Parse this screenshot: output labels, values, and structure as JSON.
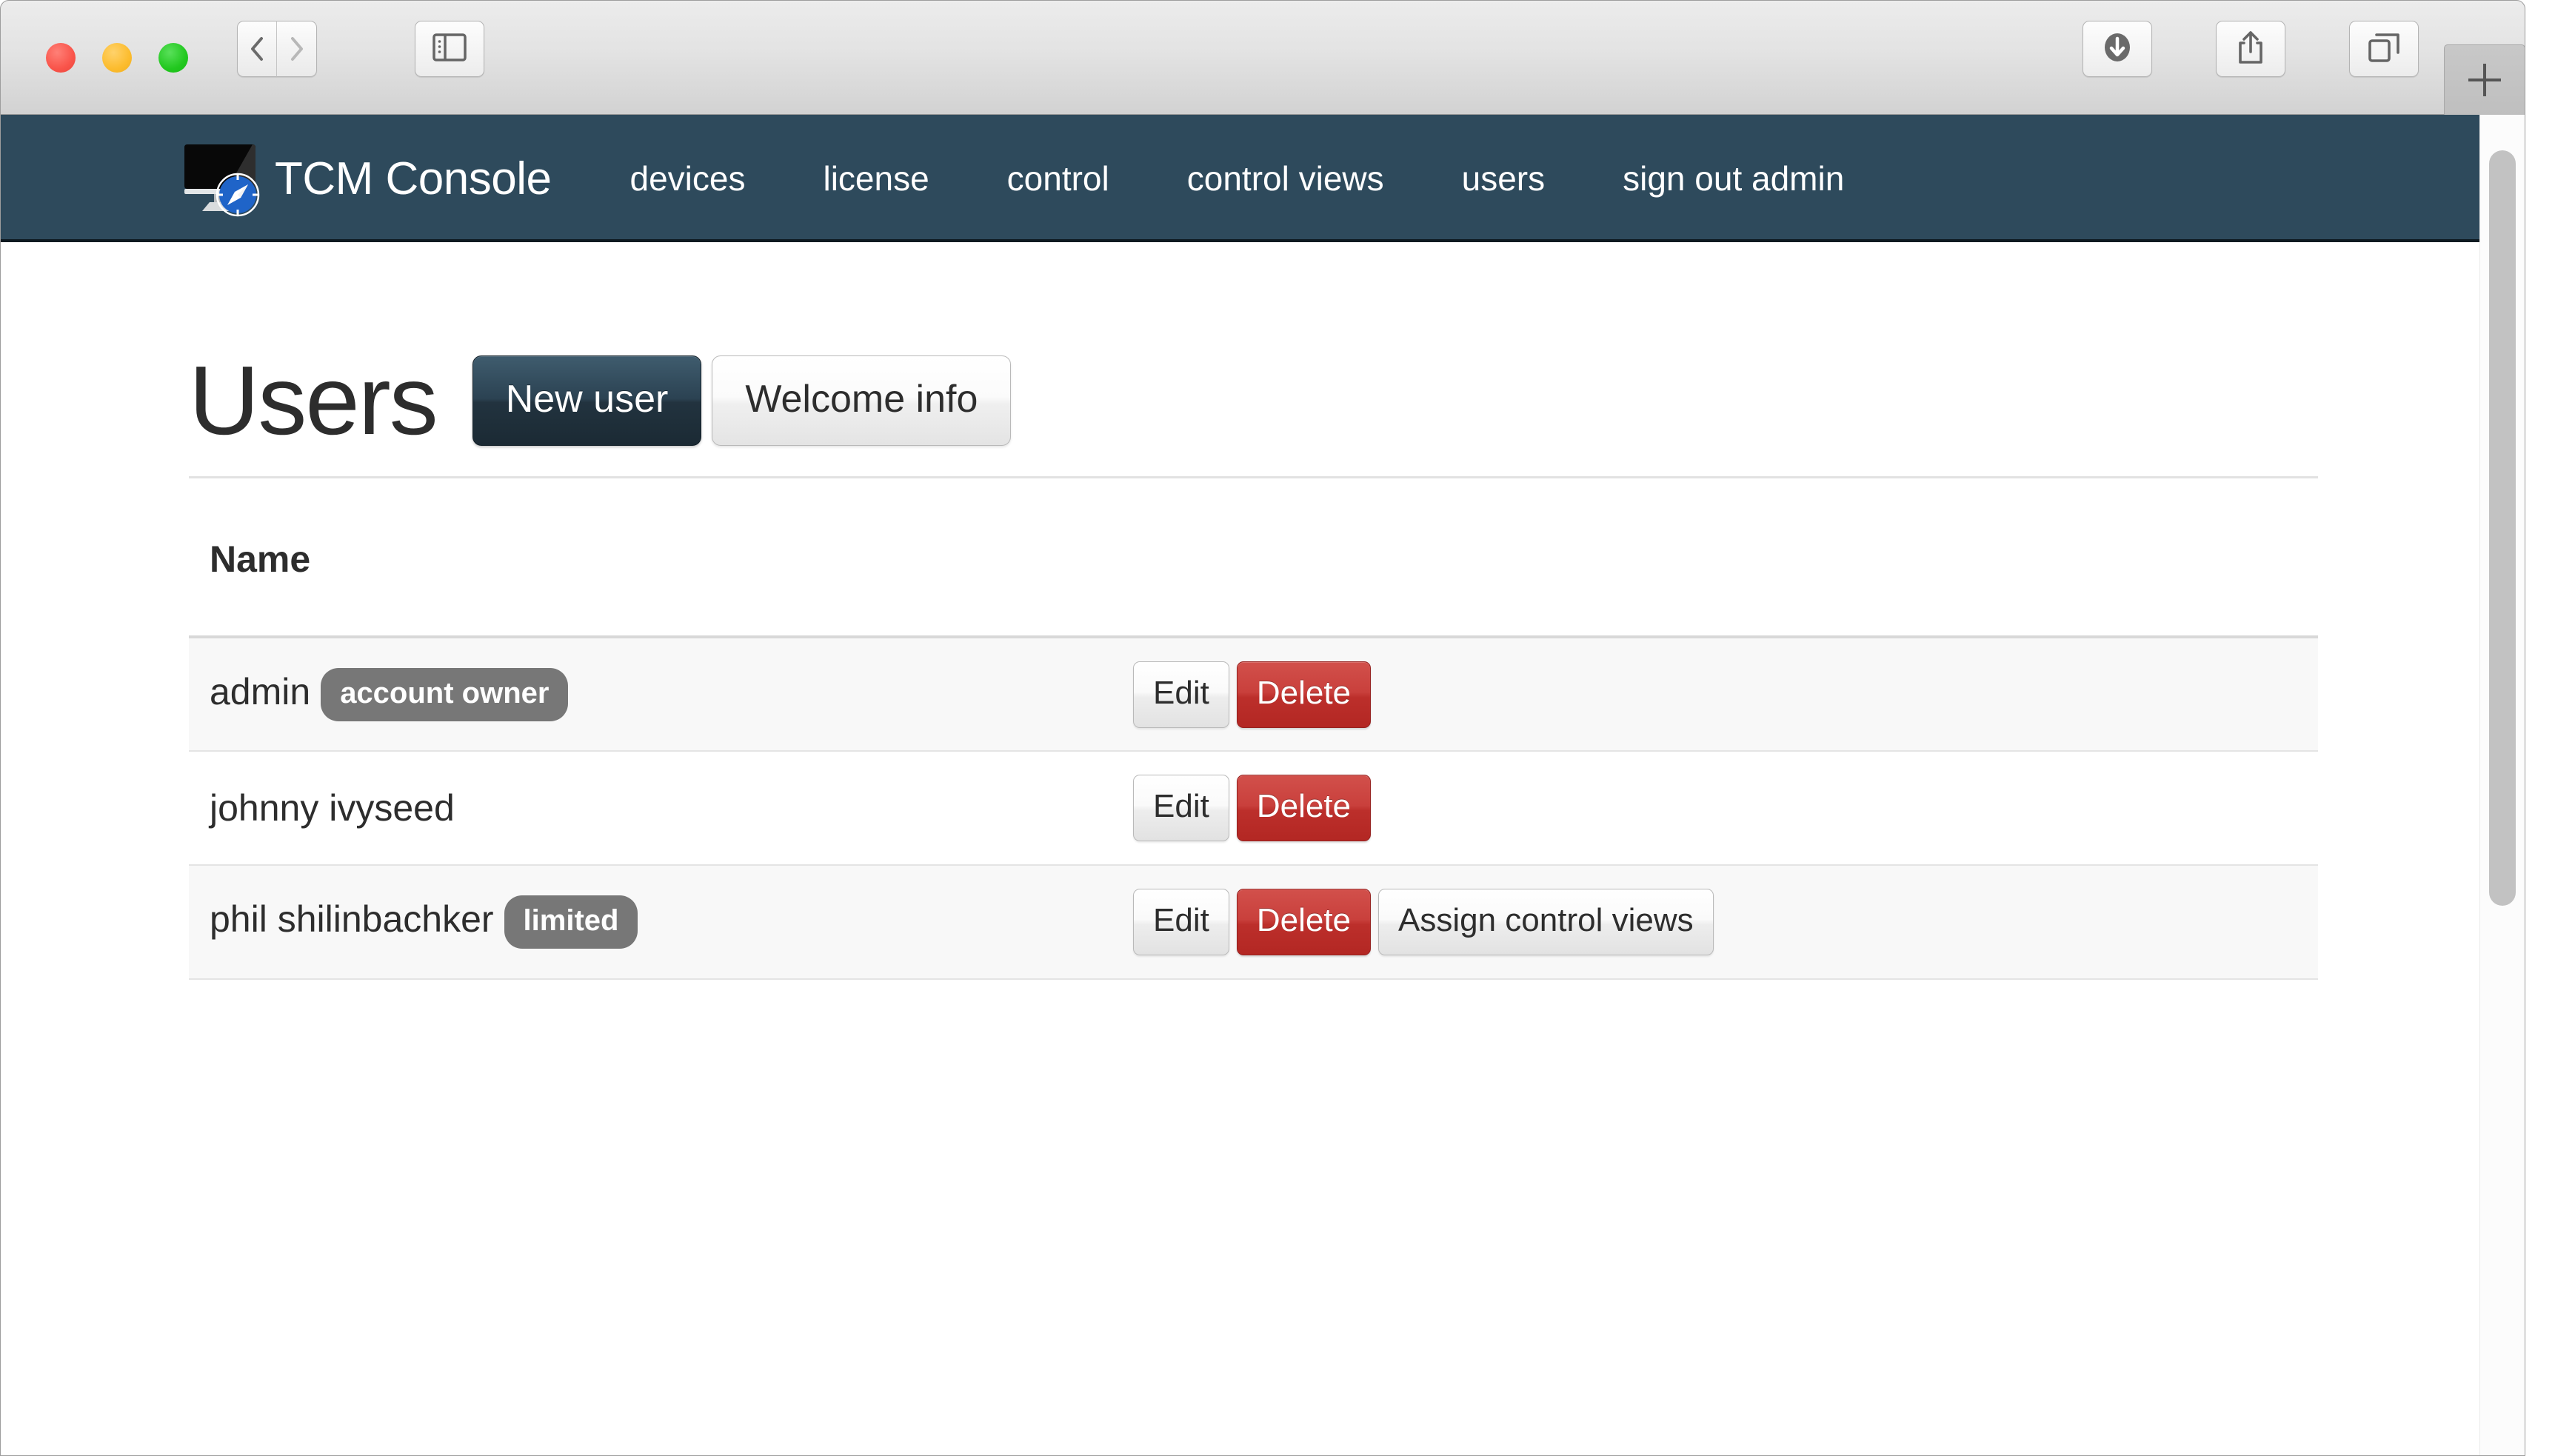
{
  "browser": {
    "traffic_lights": [
      "close-red",
      "minimize-yellow",
      "zoom-green"
    ],
    "back_icon": "chevron-left-icon",
    "forward_icon": "chevron-right-icon",
    "sidebar_icon": "sidebar-toggle-icon",
    "downloads_icon": "downloads-arrow-icon",
    "share_icon": "share-upload-icon",
    "tabs_icon": "show-all-tabs-icon",
    "new_tab_label": "+"
  },
  "navbar": {
    "logo_icon": "monitor-compass-logo-icon",
    "brand": "TCM Console",
    "links": [
      {
        "label": "devices"
      },
      {
        "label": "license"
      },
      {
        "label": "control"
      },
      {
        "label": "control views"
      },
      {
        "label": "users"
      },
      {
        "label": "sign out admin"
      }
    ],
    "background_color": "#2e4a5c"
  },
  "page": {
    "title": "Users",
    "actions": [
      {
        "label": "New user",
        "style": "primary"
      },
      {
        "label": "Welcome info",
        "style": "default"
      }
    ]
  },
  "table": {
    "columns": [
      "Name"
    ],
    "rows": [
      {
        "name": "admin",
        "badge": "account owner",
        "buttons": [
          {
            "label": "Edit",
            "style": "default"
          },
          {
            "label": "Delete",
            "style": "danger"
          }
        ]
      },
      {
        "name": "johnny ivyseed",
        "badge": "",
        "buttons": [
          {
            "label": "Edit",
            "style": "default"
          },
          {
            "label": "Delete",
            "style": "danger"
          }
        ]
      },
      {
        "name": "phil shilinbachker",
        "badge": "limited",
        "buttons": [
          {
            "label": "Edit",
            "style": "default"
          },
          {
            "label": "Delete",
            "style": "danger"
          },
          {
            "label": "Assign control views",
            "style": "default"
          }
        ]
      }
    ]
  },
  "colors": {
    "navbar": "#2e4a5c",
    "primary_button": "#22333f",
    "danger_button": "#bc2f2b",
    "badge": "#777777",
    "text": "#2d2d2d"
  }
}
